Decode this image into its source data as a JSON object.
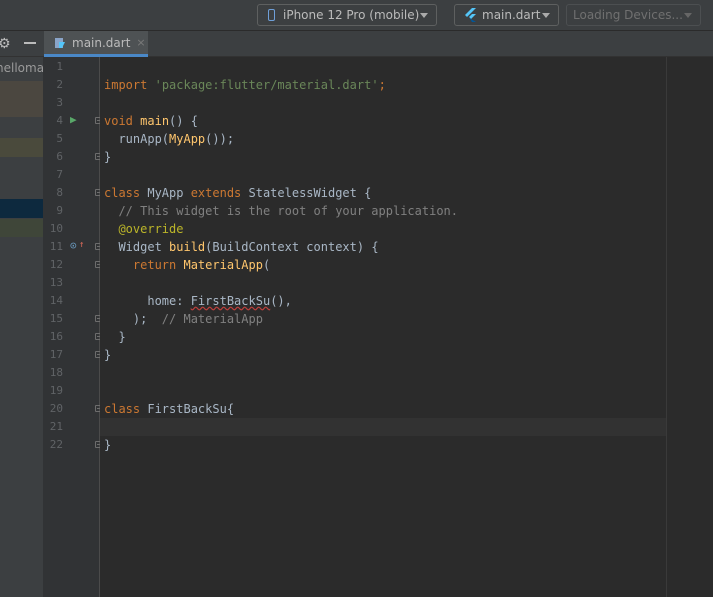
{
  "toolbar": {
    "device_label": "iPhone 12 Pro (mobile)",
    "config_label": "main.dart",
    "loading_label": "Loading Devices..."
  },
  "tab": {
    "label": "main.dart",
    "close": "×"
  },
  "project": {
    "name": "hellomar"
  },
  "colors": {
    "keyword": "#cc7832",
    "string": "#6a8759",
    "function": "#ffc66d",
    "comment": "#808080",
    "annotation": "#bbb529",
    "error": "#bc3f3c"
  },
  "editor": {
    "line_numbers": [
      "1",
      "2",
      "3",
      "4",
      "5",
      "6",
      "7",
      "8",
      "9",
      "10",
      "11",
      "12",
      "13",
      "14",
      "15",
      "16",
      "17",
      "18",
      "19",
      "20",
      "21",
      "22"
    ],
    "code": {
      "l2_import": "import",
      "l2_str": "'package:flutter/material.dart'",
      "l2_semi": ";",
      "l4_void": "void",
      "l4_main": "main",
      "l4_rest": "() {",
      "l5_runapp": "  runApp(",
      "l5_myapp": "MyApp",
      "l5_rest": "());",
      "l6": "}",
      "l8_class": "class",
      "l8_myapp": " MyApp ",
      "l8_extends": "extends",
      "l8_rest": " StatelessWidget {",
      "l9_comment": "  // This widget is the root of your application.",
      "l10_override": "  @override",
      "l11_widget": "  Widget ",
      "l11_build": "build",
      "l11_rest": "(BuildContext context) {",
      "l12_return": "    return ",
      "l12_material": "MaterialApp",
      "l12_rest": "(",
      "l14_home": "      home: ",
      "l14_first": "FirstBackSu",
      "l14_rest": "(),",
      "l15_close": "    );",
      "l15_comment": "  // MaterialApp",
      "l16": "  }",
      "l17": "}",
      "l20_class": "class",
      "l20_rest": " FirstBackSu{",
      "l22": "}"
    }
  }
}
